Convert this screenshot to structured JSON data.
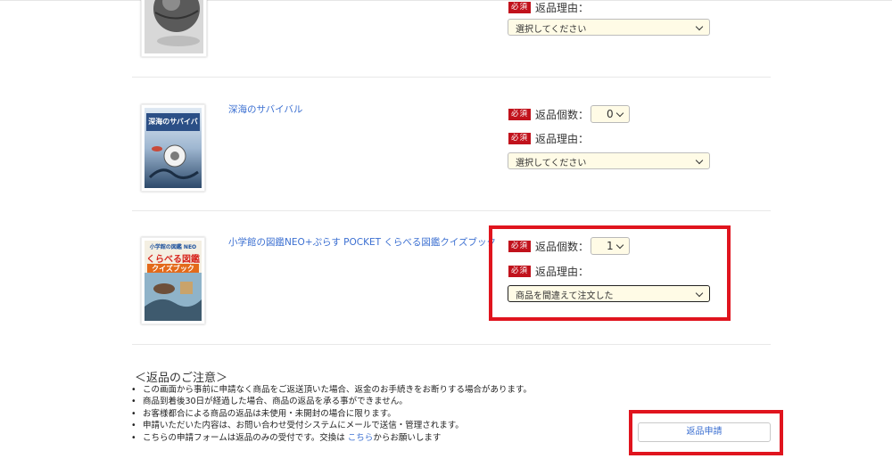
{
  "required_badge": "必須",
  "qty_label": "返品個数：",
  "reason_label": "返品理由：",
  "items": [
    {
      "reason_value": "選択してください",
      "cover_desc": "sphere-image"
    },
    {
      "title": "深海のサバイバル",
      "qty_value": "0",
      "reason_value": "選択してください",
      "cover_text": "深海のサバイバル"
    },
    {
      "title": "小学館の図鑑NEO+ぷらす POCKET くらべる図鑑クイズブック",
      "qty_value": "1",
      "reason_value": "商品を間違えて注文した",
      "cover_text_top": "小学館の図鑑 NEO",
      "cover_text_main": "くらべる図鑑",
      "cover_text_sub": "クイズブック"
    }
  ],
  "notice": {
    "title": "＜返品のご注意＞",
    "lines": [
      "この画面から事前に申請なく商品をご返送頂いた場合、返金のお手続きをお断りする場合があります。",
      "商品到着後30日が経過した場合、商品の返品を承る事ができません。",
      "お客様都合による商品の返品は未使用・未開封の場合に限ります。",
      "申請いただいた内容は、お問い合わせ受付システムにメールで送信・管理されます。"
    ],
    "last_line_prefix": "こちらの申請フォームは返品のみの受付です。交換は ",
    "last_line_link": "こちら",
    "last_line_suffix": "からお願いします"
  },
  "submit_label": "返品申請",
  "colors": {
    "required_badge_bg": "#c1121c",
    "highlight_border": "#e0141e",
    "link": "#3b6fd1",
    "select_bg": "#fffbe6"
  }
}
